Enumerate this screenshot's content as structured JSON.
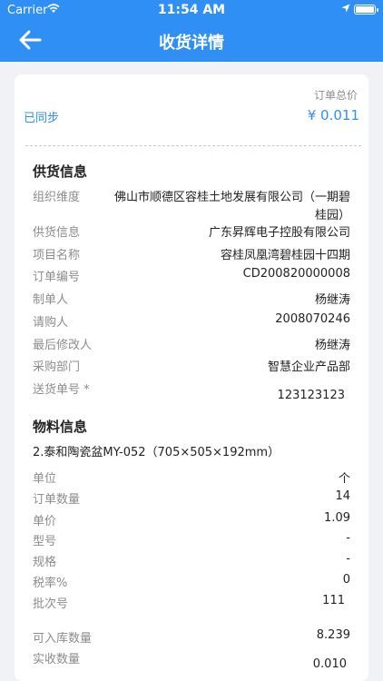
{
  "status_bar": {
    "carrier": "Carrier",
    "time": "11:54 AM"
  },
  "nav": {
    "title": "收货详情",
    "back_icon": "back-arrow-icon"
  },
  "summary": {
    "sync_status": "已同步",
    "total_label": "订单总价",
    "total_value": "¥ 0.011"
  },
  "supply": {
    "title": "供货信息",
    "org_label": "组织维度",
    "org_value_line1": "佛山市顺德区容桂土地发展有限公司（一期碧",
    "org_value_line2": "桂园）",
    "rows": [
      {
        "label": "供货信息",
        "value": "广东昇辉电子控股有限公司"
      },
      {
        "label": "项目名称",
        "value": "容桂凤凰湾碧桂园十四期"
      },
      {
        "label": "订单编号",
        "value": "CD200820000008"
      },
      {
        "label": "制单人",
        "value": "杨继涛"
      },
      {
        "label": "请购人",
        "value": "2008070246"
      },
      {
        "label": "最后修改人",
        "value": "杨继涛"
      },
      {
        "label": "采购部门",
        "value": "智慧企业产品部"
      }
    ],
    "delivery_label": "送货单号 *",
    "delivery_value": "123123123"
  },
  "material": {
    "title": "物料信息",
    "item_name": "2.泰和陶瓷盆MY-052（705×505×192mm）",
    "rows": [
      {
        "label": "单位",
        "value": "个"
      },
      {
        "label": "订单数量",
        "value": "14"
      },
      {
        "label": "单价",
        "value": "1.09"
      },
      {
        "label": "型号",
        "value": "-"
      },
      {
        "label": "规格",
        "value": "-"
      },
      {
        "label": "税率%",
        "value": "0"
      },
      {
        "label": "批次号",
        "value": "111"
      }
    ],
    "in_stock_label": "可入库数量",
    "in_stock_value": "8.239",
    "actual_label": "实收数量",
    "actual_value": "0.010"
  },
  "colors": {
    "header": "#2f8ff5",
    "background": "#f1f2f6",
    "accent": "#2f8ff5"
  }
}
